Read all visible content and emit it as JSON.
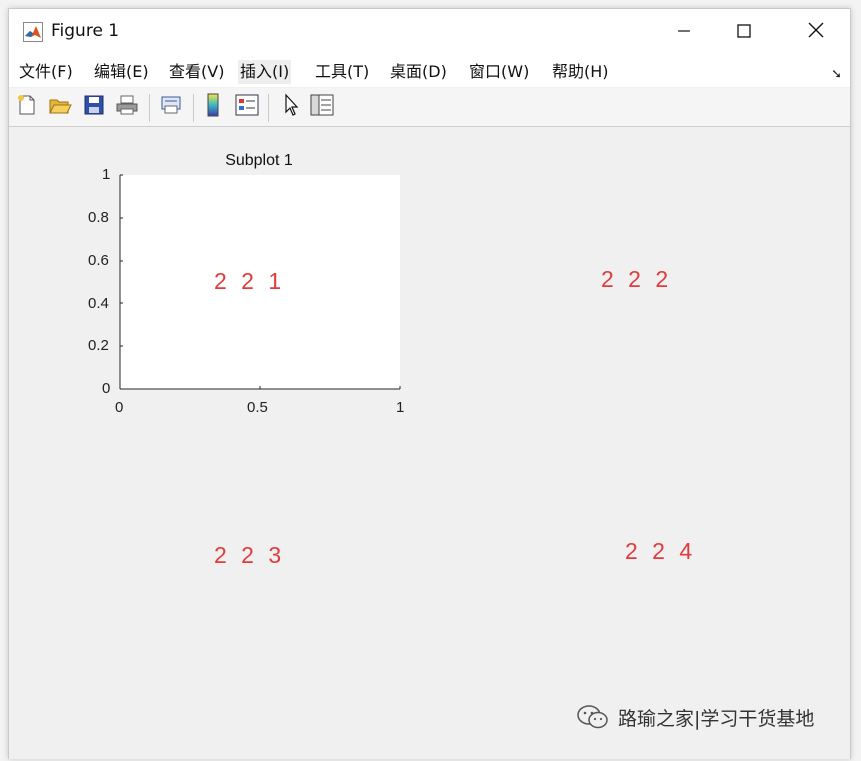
{
  "window": {
    "title": "Figure 1"
  },
  "menu": {
    "items": [
      {
        "label": "文件(F)"
      },
      {
        "label": "编辑(E)"
      },
      {
        "label": "查看(V)"
      },
      {
        "label": "插入(I)"
      },
      {
        "label": "工具(T)"
      },
      {
        "label": "桌面(D)"
      },
      {
        "label": "窗口(W)"
      },
      {
        "label": "帮助(H)"
      }
    ],
    "collapse_glyph": "➘"
  },
  "toolbar": {
    "icons": [
      "new-figure-icon",
      "open-file-icon",
      "save-icon",
      "print-icon",
      "print-preview-icon",
      "colorbar-icon",
      "legend-icon",
      "edit-plot-arrow-icon",
      "property-inspector-icon"
    ]
  },
  "subplot1": {
    "title": "Subplot 1",
    "xticks": [
      "0",
      "0.5",
      "1"
    ],
    "yticks": [
      "0",
      "0.2",
      "0.4",
      "0.6",
      "0.8",
      "1"
    ]
  },
  "annotations": {
    "a221": "2 2 1",
    "a222": "2 2 2",
    "a223": "2 2 3",
    "a224": "2 2 4"
  },
  "watermark": {
    "text": "路瑜之家|学习干货基地"
  },
  "colors": {
    "annotation": "#e23b3b",
    "window_bg": "#f0f0f0",
    "axes_bg": "#ffffff"
  }
}
